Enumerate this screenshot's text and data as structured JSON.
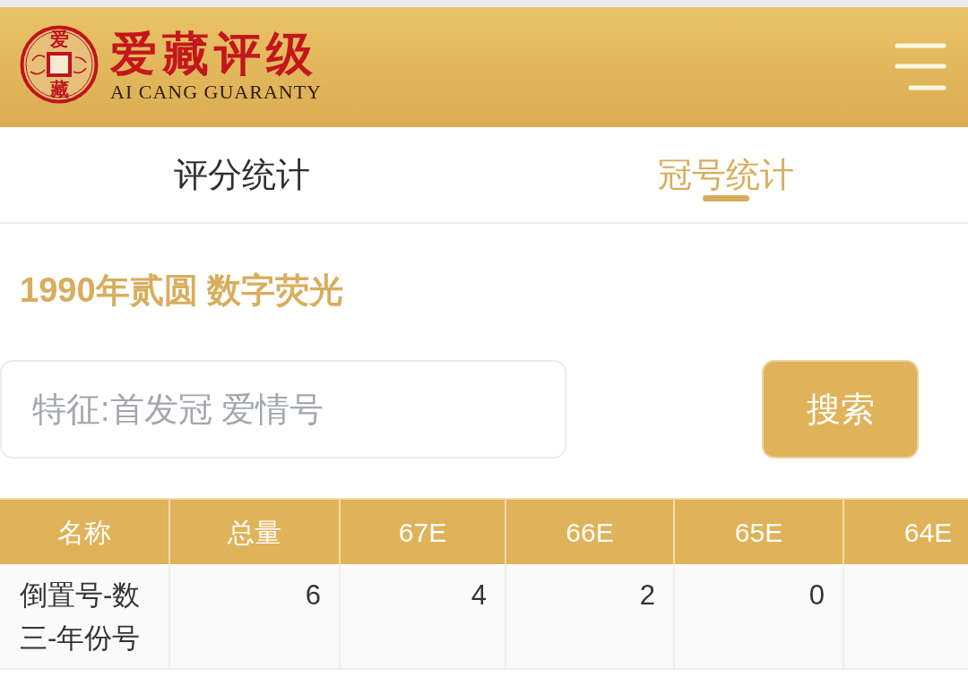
{
  "header": {
    "logo": {
      "coin_characters": [
        "爱",
        "藏"
      ],
      "name": "爱藏评级",
      "subtitle": "AI CANG GUARANTY"
    }
  },
  "tabs": [
    {
      "label": "评分统计",
      "selected": false
    },
    {
      "label": "冠号统计",
      "selected": true
    }
  ],
  "title": "1990年贰圆 数字荧光",
  "search": {
    "placeholder": "特征:首发冠 爱情号",
    "button": "搜索"
  },
  "table": {
    "columns": [
      "名称",
      "总量",
      "67E",
      "66E",
      "65E",
      "64E"
    ],
    "rows": [
      {
        "cells": [
          "倒置号-数三-年份号",
          "6",
          "4",
          "2",
          "0"
        ]
      }
    ]
  }
}
